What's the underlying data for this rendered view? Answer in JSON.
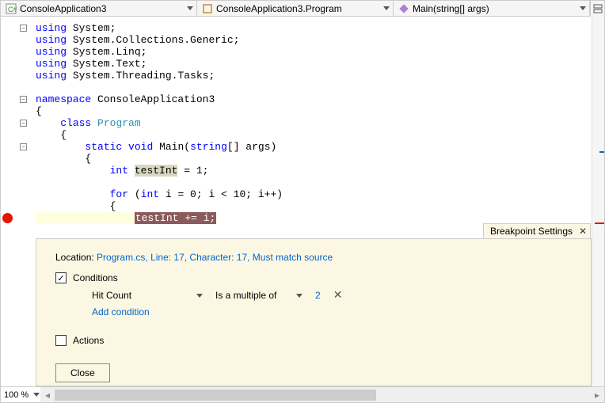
{
  "nav": {
    "scope": "ConsoleApplication3",
    "class": "ConsoleApplication3.Program",
    "member": "Main(string[] args)"
  },
  "code": {
    "lines": [
      {
        "seg": [
          [
            "kw",
            "using"
          ],
          [
            "txt",
            " System;"
          ]
        ]
      },
      {
        "seg": [
          [
            "kw",
            "using"
          ],
          [
            "txt",
            " System.Collections.Generic;"
          ]
        ]
      },
      {
        "seg": [
          [
            "kw",
            "using"
          ],
          [
            "txt",
            " System.Linq;"
          ]
        ]
      },
      {
        "seg": [
          [
            "kw",
            "using"
          ],
          [
            "txt",
            " System.Text;"
          ]
        ]
      },
      {
        "seg": [
          [
            "kw",
            "using"
          ],
          [
            "txt",
            " System.Threading.Tasks;"
          ]
        ]
      },
      {
        "seg": []
      },
      {
        "seg": [
          [
            "kw",
            "namespace"
          ],
          [
            "txt",
            " ConsoleApplication3"
          ]
        ]
      },
      {
        "seg": [
          [
            "txt",
            "{"
          ]
        ]
      },
      {
        "seg": [
          [
            "txt",
            "    "
          ],
          [
            "kw",
            "class"
          ],
          [
            "txt",
            " "
          ],
          [
            "typ",
            "Program"
          ]
        ]
      },
      {
        "seg": [
          [
            "txt",
            "    {"
          ]
        ]
      },
      {
        "seg": [
          [
            "txt",
            "        "
          ],
          [
            "kw",
            "static"
          ],
          [
            "txt",
            " "
          ],
          [
            "kw",
            "void"
          ],
          [
            "txt",
            " Main("
          ],
          [
            "kw",
            "string"
          ],
          [
            "txt",
            "[] args)"
          ]
        ]
      },
      {
        "seg": [
          [
            "txt",
            "        {"
          ]
        ]
      },
      {
        "seg": [
          [
            "txt",
            "            "
          ],
          [
            "kw",
            "int"
          ],
          [
            "txt",
            " "
          ],
          [
            "hlk",
            "testInt"
          ],
          [
            "txt",
            " = 1;"
          ]
        ]
      },
      {
        "seg": []
      },
      {
        "seg": [
          [
            "txt",
            "            "
          ],
          [
            "kw",
            "for"
          ],
          [
            "txt",
            " ("
          ],
          [
            "kw",
            "int"
          ],
          [
            "txt",
            " i = 0; i < 10; i++)"
          ]
        ]
      },
      {
        "seg": [
          [
            "txt",
            "            {"
          ]
        ]
      },
      {
        "seg": [
          [
            "txt",
            "                "
          ],
          [
            "bph",
            "testInt += i;"
          ]
        ],
        "bp": true
      }
    ],
    "outline_boxes": [
      {
        "line": 0,
        "glyph": "-"
      },
      {
        "line": 6,
        "glyph": "-"
      },
      {
        "line": 8,
        "glyph": "-"
      },
      {
        "line": 10,
        "glyph": "-"
      }
    ]
  },
  "bp_panel": {
    "title": "Breakpoint Settings",
    "location_label": "Location:",
    "location_link": "Program.cs, Line: 17, Character: 17, Must match source",
    "conditions_label": "Conditions",
    "conditions_checked": true,
    "condition_type": "Hit Count",
    "condition_op": "Is a multiple of",
    "condition_value": "2",
    "add_condition": "Add condition",
    "actions_label": "Actions",
    "actions_checked": false,
    "close_label": "Close"
  },
  "zoom": "100 %"
}
